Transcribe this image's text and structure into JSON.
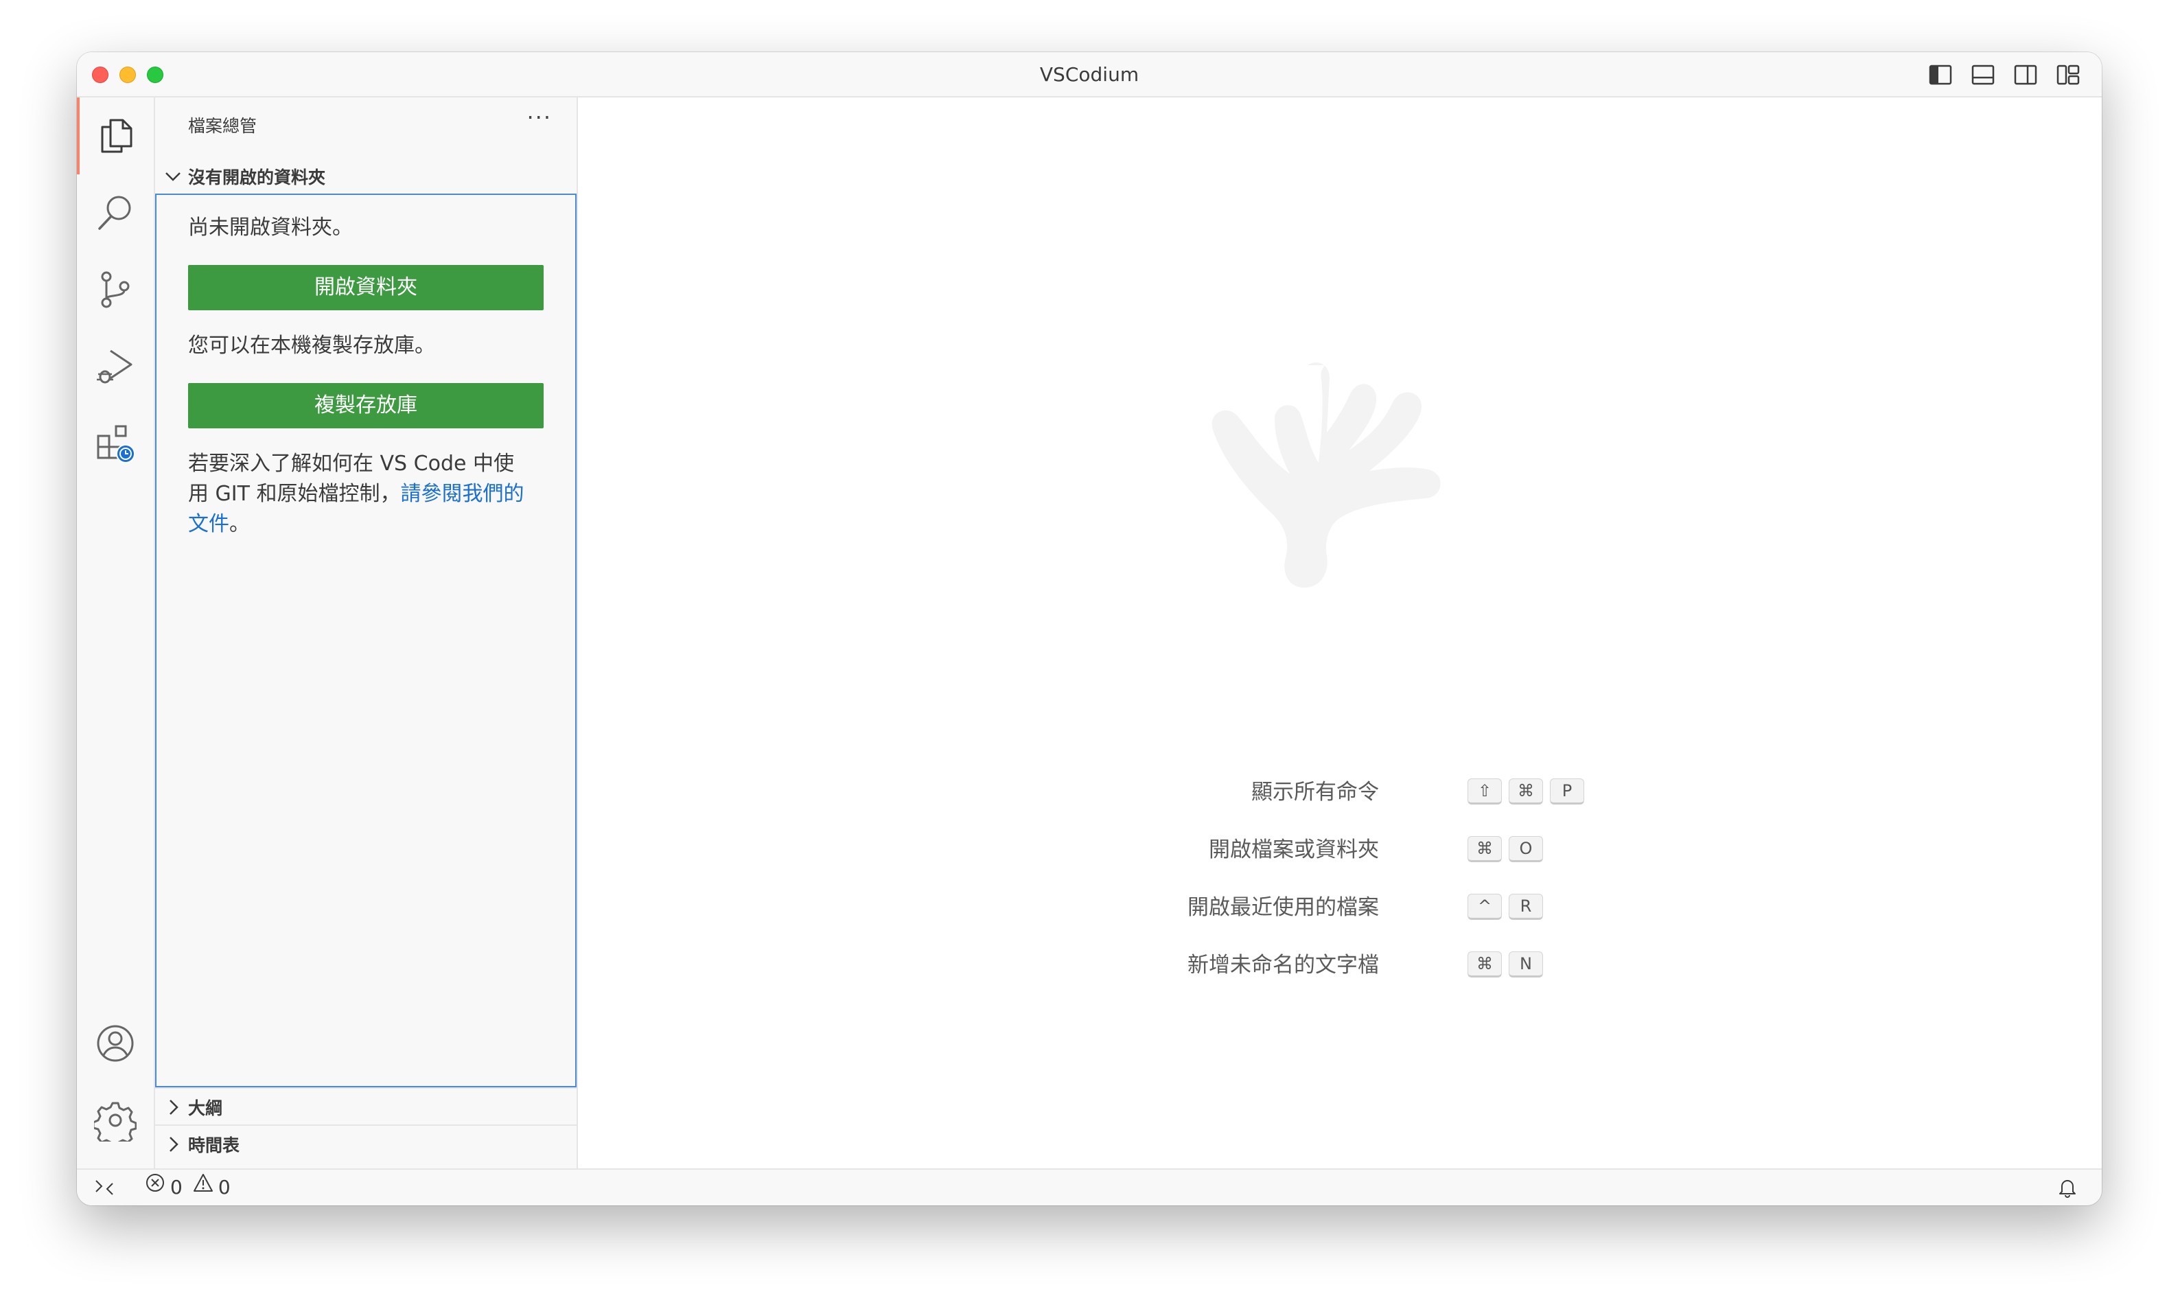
{
  "window": {
    "title": "VSCodium"
  },
  "titlebar": {
    "layout_icons": [
      "toggle-primary-sidebar-icon",
      "toggle-panel-icon",
      "toggle-secondary-sidebar-icon",
      "customize-layout-icon"
    ]
  },
  "activity_bar": {
    "items": [
      "explorer-icon",
      "search-icon",
      "source-control-icon",
      "run-debug-icon",
      "extensions-icon"
    ],
    "bottom": [
      "accounts-icon",
      "manage-gear-icon"
    ],
    "accent": "#f9826c"
  },
  "sidebar": {
    "header": "檔案總管",
    "more": "···",
    "section_no_folder": "沒有開啟的資料夾",
    "not_opened_text": "尚未開啟資料夾。",
    "open_folder_button": "開啟資料夾",
    "clone_text": "您可以在本機複製存放庫。",
    "clone_button": "複製存放庫",
    "learn_text_1": "若要深入了解如何在 VS Code 中使",
    "learn_text_2": "用 GIT 和原始檔控制，",
    "learn_link_1": "請參閱我們的",
    "learn_link_2": "文件",
    "learn_text_end": "。",
    "section_outline": "大綱",
    "section_timeline": "時間表",
    "button_color": "#3d9a41",
    "link_color": "#1a6fd4"
  },
  "editor": {
    "shortcuts": [
      {
        "label": "顯示所有命令",
        "keys": [
          "⇧",
          "⌘",
          "P"
        ]
      },
      {
        "label": "開啟檔案或資料夾",
        "keys": [
          "⌘",
          "O"
        ]
      },
      {
        "label": "開啟最近使用的檔案",
        "keys": [
          "^",
          "R"
        ]
      },
      {
        "label": "新增未命名的文字檔",
        "keys": [
          "⌘",
          "N"
        ]
      }
    ]
  },
  "statusbar": {
    "errors": "0",
    "warnings": "0"
  }
}
